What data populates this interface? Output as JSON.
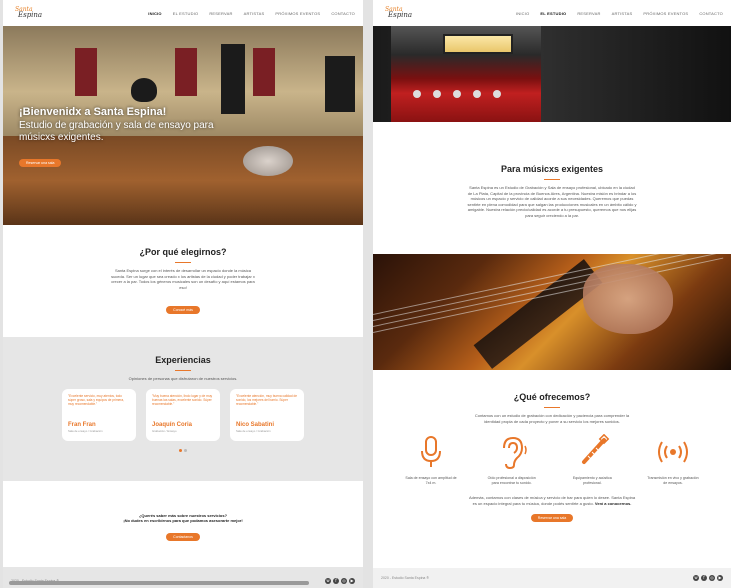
{
  "brand": {
    "logo_top": "Santa",
    "logo_bottom": "Espina",
    "accent": "#e8772a"
  },
  "left": {
    "nav": [
      "INICIO",
      "EL ESTUDIO",
      "RESERVAR",
      "ARTISTAS",
      "PRÓXIMOS EVENTOS",
      "CONTACTO"
    ],
    "hero": {
      "title": "¡Bienvenidx a Santa Espina!",
      "subtitle": "Estudio de grabación y sala de ensayo para músicxs exigentes.",
      "button": "Reservar una sala"
    },
    "why": {
      "title": "¿Por qué elegirnos?",
      "text": "Santa Espina surge con el interés de desarrollar un espacio donde la música suceda. Ser un lugar que sea creado x los artistas de la ciudad y poder trabajar x crecer a la par. Todos los géneros musicales son un desafío y aquí estamos para eso!",
      "button": "Conocé más"
    },
    "experiences": {
      "title": "Experiencias",
      "subtitle": "Opiniones de personas que disfrutaron de nuestros servicios.",
      "cards": [
        {
          "quote": "\"Excelente servicio, muy atentos, todo súper groso, sala y equipos de primera, muy recomendable.\"",
          "name": "Fran Fran",
          "role": "Sala de ensayo / Grabación"
        },
        {
          "quote": "\"Muy buena atención, lindo lugar y de muy buenas las salas, excelente sonido. Súper recomendable.\"",
          "name": "Joaquín Coria",
          "role": "Grabación / Ensayo"
        },
        {
          "quote": "\"Excelente atención, muy buena calidad de sonido, los mejores del barrio. Súper recomendable.\"",
          "name": "Nico Sabatini",
          "role": "Sala de ensayo / Grabación"
        }
      ]
    },
    "cta": {
      "line1": "¿Querés saber más sobre nuestros servicios?",
      "line2": "¡No dudes en escribirnos para que podamos asesorarte mejor!",
      "button": "Contactanos"
    },
    "footer": "2020 - Estudio Santa Espina ®"
  },
  "right": {
    "nav": [
      "INICIO",
      "EL ESTUDIO",
      "RESERVAR",
      "ARTISTAS",
      "PRÓXIMOS EVENTOS",
      "CONTACTO"
    ],
    "musicians": {
      "title": "Para músicxs exigentes",
      "text": "Santa Espina es un Estudio de Grabación y Sala de ensayo profesional, ubicado en la ciudad de La Plata, Capital de la provincia de Buenos Aires, Argentina. Nuestra misión es brindar a los músicos un espacio y servicio de calidad acorde a sus necesidades. Queremos que puedas sentirte en plena comodidad para que salgan las producciones musicales en un ámbito cálido y amigable. Nuestra relación precio/calidad es acorde a tu presupuesto, queremos que nos elijas para seguir creciendo a la par."
    },
    "offer": {
      "title": "¿Qué ofrecemos?",
      "intro": "Contamos con un estudio de grabación con dedicación y paciencia para comprender la identidad propia de cada proyecto y poner a su servicio los mejores sonidos.",
      "services": [
        {
          "icon": "microphone-icon",
          "text": "Sala de ensayo con amplitud de 7x4 m."
        },
        {
          "icon": "ear-icon",
          "text": "Oído profesional a disposición para encontrar tu sonido."
        },
        {
          "icon": "guitar-icon",
          "text": "Equipamiento y acústica profesional."
        },
        {
          "icon": "broadcast-icon",
          "text": "Transmisión en vivo y grabación de ensayos."
        }
      ],
      "outro": "Además, contamos con clases de música y servicio de bar para quien lo desee. Santa Espina es un espacio integral para tu música, donde podés sentirte a gusto.",
      "outro_bold": "Vení a conocernos.",
      "button": "Reservar una sala"
    },
    "footer": "2020 - Estudio Santa Espina ®"
  },
  "socials": [
    "whatsapp-icon",
    "facebook-icon",
    "instagram-icon",
    "youtube-icon"
  ]
}
